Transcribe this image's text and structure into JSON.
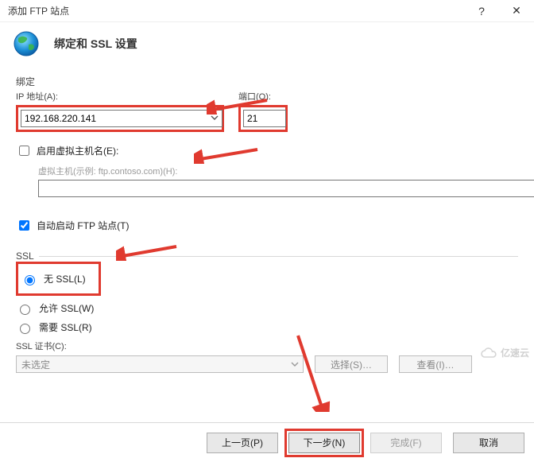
{
  "window": {
    "title": "添加 FTP 站点",
    "help": "?",
    "close": "✕"
  },
  "header": {
    "title": "绑定和 SSL 设置"
  },
  "binding": {
    "section": "绑定",
    "ip_label": "IP 地址(A):",
    "ip_value": "192.168.220.141",
    "port_label": "端口(O):",
    "port_value": "21"
  },
  "vhost": {
    "checkbox_label": "启用虚拟主机名(E):",
    "example_label": "虚拟主机(示例: ftp.contoso.com)(H):",
    "value": ""
  },
  "autostart": {
    "label": "自动启动 FTP 站点(T)"
  },
  "ssl": {
    "legend": "SSL",
    "none": "无 SSL(L)",
    "allow": "允许 SSL(W)",
    "require": "需要 SSL(R)",
    "cert_label": "SSL 证书(C):",
    "cert_value": "未选定",
    "select_btn": "选择(S)…",
    "view_btn": "查看(I)…"
  },
  "footer": {
    "prev": "上一页(P)",
    "next": "下一步(N)",
    "finish": "完成(F)",
    "cancel": "取消"
  },
  "watermark": "亿速云"
}
